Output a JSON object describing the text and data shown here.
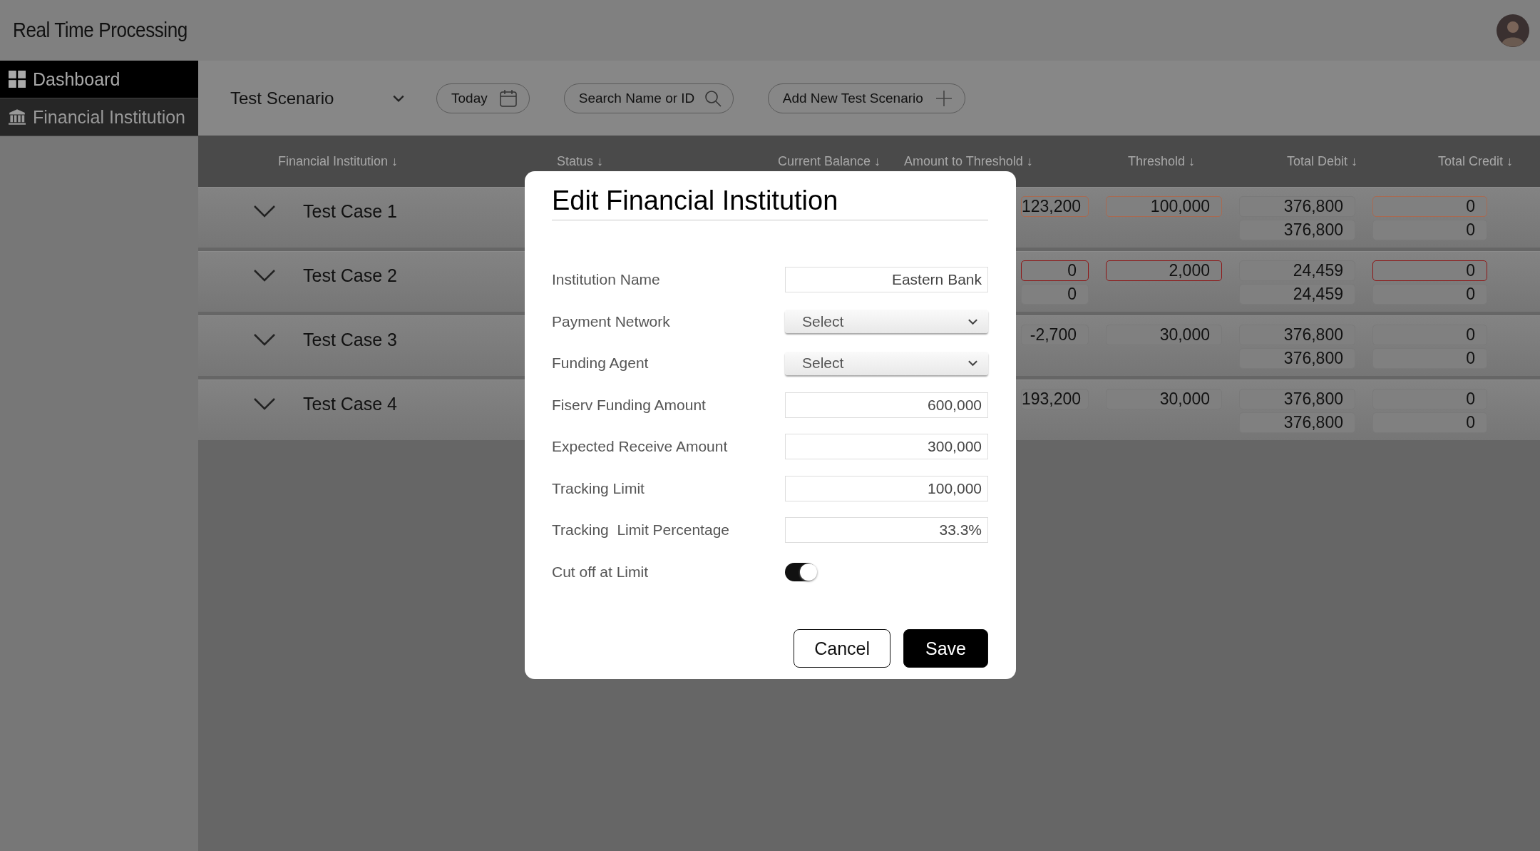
{
  "header": {
    "title": "Real Time Processing"
  },
  "sidebar": {
    "items": [
      {
        "label": "Dashboard",
        "kind": "grid",
        "selected": true
      },
      {
        "label": "Financial Institution",
        "kind": "bank",
        "selected": false
      }
    ]
  },
  "toolbar": {
    "scenario": "Test Scenario",
    "date": "Today",
    "search": {
      "placeholder": "Search Name or ID"
    },
    "add_button": "Add New Test Scenario"
  },
  "table": {
    "columns": [
      "Financial Institution ↓",
      "Status ↓",
      "Current Balance ↓",
      "Amount to Threshold ↓",
      "Threshold ↓",
      "Total Debit ↓",
      "Total Credit ↓"
    ],
    "rows": [
      {
        "name": "Test Case 1",
        "amount": [
          {
            "text": "123,200",
            "color": "#a86a52"
          }
        ],
        "threshold": [
          {
            "text": "100,000",
            "color": "#a86a52"
          }
        ],
        "debit": [
          {
            "text": "376,800"
          },
          {
            "text": "376,800"
          }
        ],
        "credit": [
          {
            "text": "0",
            "color": "#a86a52"
          },
          {
            "text": "0"
          }
        ]
      },
      {
        "name": "Test Case 2",
        "amount": [
          {
            "text": "0",
            "color": "#8e1515"
          },
          {
            "text": "0"
          }
        ],
        "threshold": [
          {
            "text": "2,000",
            "color": "#8e1515"
          }
        ],
        "debit": [
          {
            "text": "24,459"
          },
          {
            "text": "24,459"
          }
        ],
        "credit": [
          {
            "text": "0",
            "color": "#8e1515"
          },
          {
            "text": "0"
          }
        ]
      },
      {
        "name": "Test Case 3",
        "amount": [
          {
            "text": "-2,700"
          }
        ],
        "threshold": [
          {
            "text": "30,000"
          }
        ],
        "debit": [
          {
            "text": "376,800"
          },
          {
            "text": "376,800"
          }
        ],
        "credit": [
          {
            "text": "0"
          },
          {
            "text": "0"
          }
        ]
      },
      {
        "name": "Test Case 4",
        "amount": [
          {
            "text": "193,200"
          }
        ],
        "threshold": [
          {
            "text": "30,000"
          }
        ],
        "debit": [
          {
            "text": "376,800"
          },
          {
            "text": "376,800"
          }
        ],
        "credit": [
          {
            "text": "0"
          },
          {
            "text": "0"
          }
        ]
      }
    ]
  },
  "modal": {
    "title": "Edit Financial Institution",
    "fields": [
      {
        "kind": "text",
        "label": "Institution Name",
        "value": "Eastern Bank"
      },
      {
        "kind": "select",
        "label": "Payment Network",
        "value": "Select"
      },
      {
        "kind": "select",
        "label": "Funding Agent",
        "value": "Select"
      },
      {
        "kind": "text",
        "label": "Fiserv Funding Amount",
        "value": "600,000"
      },
      {
        "kind": "text",
        "label": "Expected Receive Amount",
        "value": "300,000"
      },
      {
        "kind": "text",
        "label": "Tracking Limit",
        "value": "100,000"
      },
      {
        "kind": "text",
        "label": "Tracking  Limit Percentage",
        "value": "33.3%"
      },
      {
        "kind": "toggle",
        "label": "Cut off at Limit",
        "on": true
      }
    ],
    "buttons": [
      {
        "label": "Cancel",
        "primary": false
      },
      {
        "label": "Save",
        "primary": true
      }
    ]
  }
}
